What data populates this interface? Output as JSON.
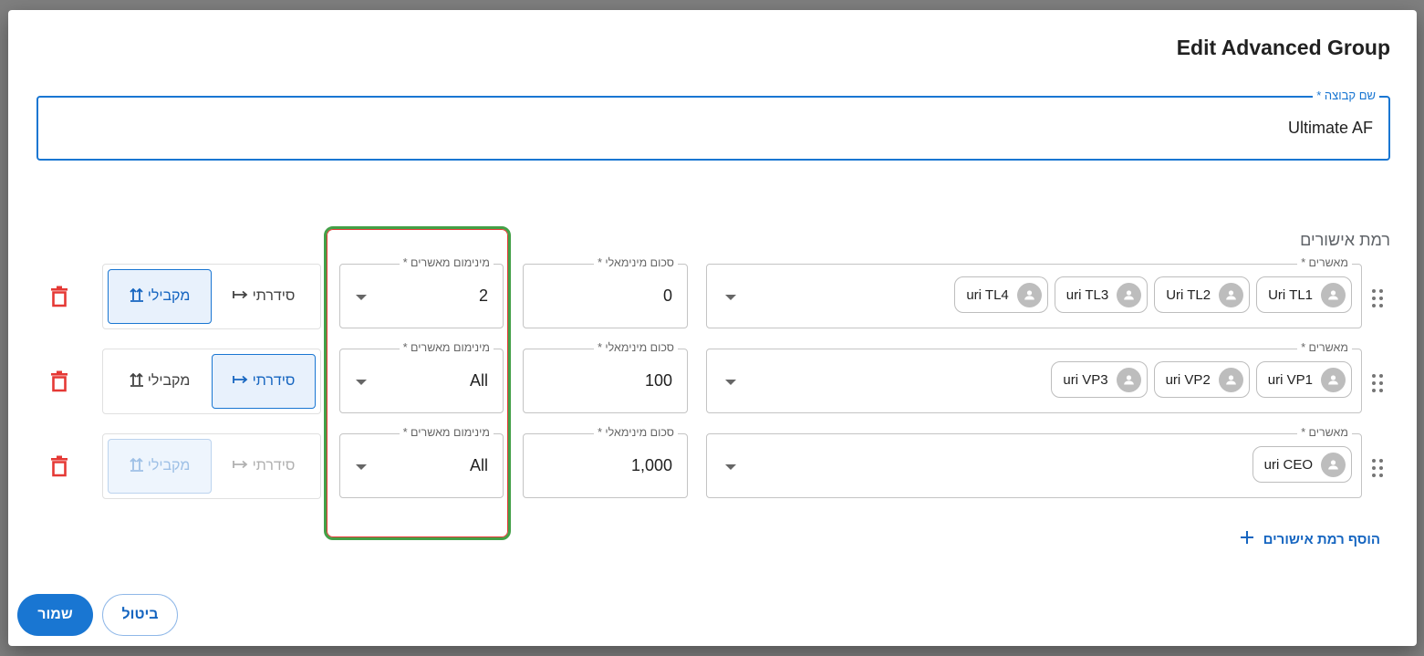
{
  "dialog": {
    "title": "Edit Advanced Group",
    "group_name_label": "שם קבוצה *",
    "group_name_value": "Ultimate AF",
    "levels_title": "רמת אישורים",
    "add_level_label": "הוסף רמת אישורים",
    "save_label": "שמור",
    "cancel_label": "ביטול"
  },
  "levels": [
    {
      "approvers_label": "מאשרים *",
      "approvers": [
        "Uri TL1",
        "Uri TL2",
        "uri TL3",
        "uri TL4"
      ],
      "min_amount_label": "סכום מינימאלי *",
      "min_amount": "0",
      "min_approvers_label": "מינימום מאשרים *",
      "min_approvers": "2",
      "serial_label": "סידרתי",
      "parallel_label": "מקבילי",
      "mode": "parallel"
    },
    {
      "approvers_label": "מאשרים *",
      "approvers": [
        "uri VP1",
        "uri VP2",
        "uri VP3"
      ],
      "min_amount_label": "סכום מינימאלי *",
      "min_amount": "100",
      "min_approvers_label": "מינימום מאשרים *",
      "min_approvers": "All",
      "serial_label": "סידרתי",
      "parallel_label": "מקבילי",
      "mode": "serial"
    },
    {
      "approvers_label": "מאשרים *",
      "approvers": [
        "uri CEO"
      ],
      "min_amount_label": "סכום מינימאלי *",
      "min_amount": "1,000",
      "min_approvers_label": "מינימום מאשרים *",
      "min_approvers": "All",
      "serial_label": "סידרתי",
      "parallel_label": "מקבילי",
      "mode": "parallel-disabled"
    }
  ],
  "colors": {
    "primary": "#1976d2",
    "danger": "#e53935",
    "highlight": "#43a047"
  }
}
